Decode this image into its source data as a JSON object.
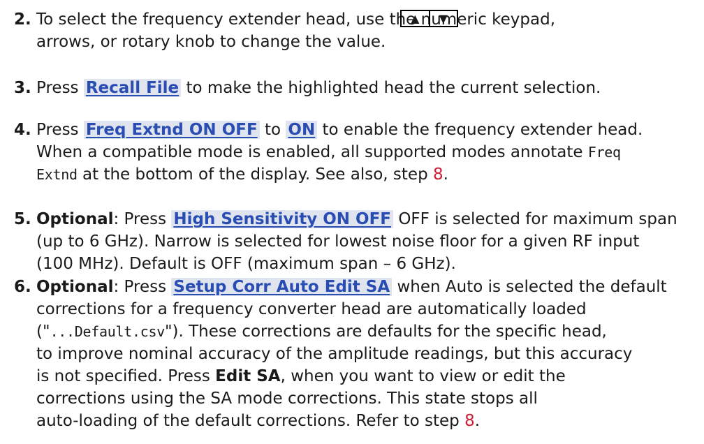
{
  "steps": [
    {
      "num": "2.",
      "line1": "To select the frequency extender head, use the numeric keypad,",
      "line2": "arrows, or rotary knob to change the value."
    },
    {
      "num": "3.",
      "pre": "Press ",
      "key": "Recall File",
      "post": " to make the highlighted head the current selection."
    },
    {
      "num": "4.",
      "pre": "Press ",
      "key1": "Freq Extnd ON OFF",
      "mid": " to ",
      "key2": "ON",
      "post": " to enable the frequency extender head.",
      "line2_pre": "When a compatible mode is enabled, all supported modes annotate ",
      "code_a": "Freq",
      "code_b": "Extnd",
      "line3_post": " at the bottom of the display. See also, step ",
      "ref": "8",
      "end": "."
    },
    {
      "num": "5.",
      "opt": "Optional",
      "pre": ": Press ",
      "key": "High Sensitivity ON OFF",
      "post": " OFF is selected for maximum span",
      "line2": "(up to 6 GHz). Narrow is selected for lowest noise floor for a given RF input",
      "line3": "(100 MHz). Default is OFF (maximum span – 6 GHz)."
    },
    {
      "num": "6.",
      "opt": "Optional",
      "pre": ": Press ",
      "key": "Setup Corr Auto Edit SA",
      "post": " when Auto is selected the default",
      "line2": "corrections for a frequency converter head are automatically loaded",
      "line3_pre": "(\"",
      "code": "...Default.csv",
      "line3_post": "\"). These corrections are defaults for the specific head,",
      "line4": "to improve nominal accuracy of the amplitude readings, but this accuracy",
      "line5_pre": "is not specified. Press ",
      "bold": "Edit SA",
      "line5_post": ", when you want to view or edit the",
      "line6": "corrections using the SA mode corrections. This state stops all",
      "line7_pre": "auto-loading of the default corrections. Refer to step ",
      "ref": "8",
      "end": "."
    }
  ]
}
